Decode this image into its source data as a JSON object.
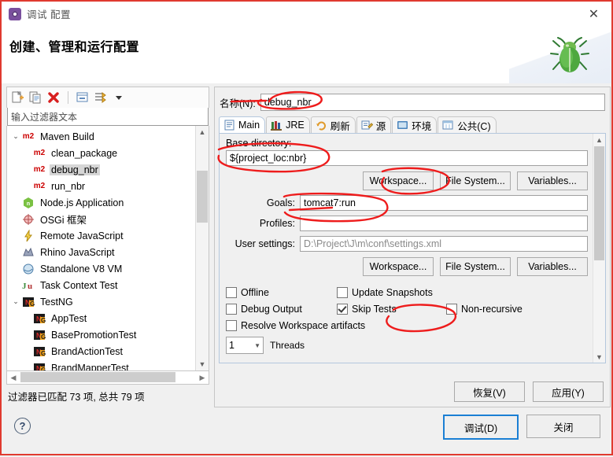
{
  "window": {
    "title": "调试 配置",
    "title_icon": "gear-icon",
    "close_icon": "✕",
    "heading": "创建、管理和运行配置",
    "banner_icon": "green-bug-icon"
  },
  "left_panel": {
    "toolbar": [
      {
        "name": "new-configuration-icon",
        "label": "新建"
      },
      {
        "name": "duplicate-configuration-icon",
        "label": "复制"
      },
      {
        "name": "delete-configuration-icon",
        "label": "删除"
      },
      {
        "name": "collapse-all-icon",
        "label": "全部折叠"
      },
      {
        "name": "filter-icon",
        "label": "过滤"
      },
      {
        "name": "toolbar-menu-chevron-icon",
        "label": "▾"
      }
    ],
    "filter_placeholder": "输入过滤器文本",
    "filter_value": "",
    "tree": [
      {
        "label": "Maven Build",
        "icon": "m2",
        "indent": 0,
        "expanded": true,
        "selected": false
      },
      {
        "label": "clean_package",
        "icon": "m2",
        "indent": 1,
        "selected": false
      },
      {
        "label": "debug_nbr",
        "icon": "m2",
        "indent": 1,
        "selected": true
      },
      {
        "label": "run_nbr",
        "icon": "m2",
        "indent": 1,
        "selected": false
      },
      {
        "label": "Node.js Application",
        "icon": "nodejs",
        "indent": 0,
        "selected": false
      },
      {
        "label": "OSGi 框架",
        "icon": "osgi",
        "indent": 0,
        "selected": false
      },
      {
        "label": "Remote JavaScript",
        "icon": "js-remote",
        "indent": 0,
        "selected": false
      },
      {
        "label": "Rhino JavaScript",
        "icon": "rhino",
        "indent": 0,
        "selected": false
      },
      {
        "label": "Standalone V8 VM",
        "icon": "v8",
        "indent": 0,
        "selected": false
      },
      {
        "label": "Task Context Test",
        "icon": "junit",
        "indent": 0,
        "selected": false
      },
      {
        "label": "TestNG",
        "icon": "testng",
        "indent": 0,
        "expanded": true,
        "selected": false
      },
      {
        "label": "AppTest",
        "icon": "testng",
        "indent": 1,
        "selected": false
      },
      {
        "label": "BasePromotionTest",
        "icon": "testng",
        "indent": 1,
        "selected": false
      },
      {
        "label": "BrandActionTest",
        "icon": "testng",
        "indent": 1,
        "selected": false
      },
      {
        "label": "BrandMapperTest",
        "icon": "testng",
        "indent": 1,
        "selected": false
      }
    ],
    "status": "过滤器已匹配 73 项, 总共 79 项"
  },
  "config": {
    "name_label": "名称(N):",
    "name_value": "debug_nbr",
    "tabs": [
      {
        "label": "Main",
        "icon": "main-tab-icon",
        "active": true
      },
      {
        "label": "JRE",
        "icon": "jre-tab-icon",
        "active": false
      },
      {
        "label": "刷新",
        "icon": "refresh-tab-icon",
        "active": false
      },
      {
        "label": "源",
        "icon": "source-tab-icon",
        "active": false
      },
      {
        "label": "环境",
        "icon": "environment-tab-icon",
        "active": false
      },
      {
        "label": "公共(C)",
        "icon": "common-tab-icon",
        "active": false
      }
    ],
    "base_directory_label": "Base directory:",
    "base_directory_value": "${project_loc:nbr}",
    "dir_buttons": [
      "Workspace...",
      "File System...",
      "Variables..."
    ],
    "goals_label": "Goals:",
    "goals_value": "tomcat7:run",
    "profiles_label": "Profiles:",
    "profiles_value": "",
    "user_settings_label": "User settings:",
    "user_settings_value": "D:\\Project\\J\\m\\conf\\settings.xml",
    "settings_buttons": [
      "Workspace...",
      "File System...",
      "Variables..."
    ],
    "checkboxes": [
      {
        "label": "Offline",
        "checked": false
      },
      {
        "label": "Update Snapshots",
        "checked": false
      },
      {
        "label": "Debug Output",
        "checked": false
      },
      {
        "label": "Skip Tests",
        "checked": true
      },
      {
        "label": "Non-recursive",
        "checked": false
      },
      {
        "label": "Resolve Workspace artifacts",
        "checked": false
      }
    ],
    "threads_value": "1",
    "threads_label": "Threads",
    "revert_label": "恢复(V)",
    "apply_label": "应用(Y)"
  },
  "footer": {
    "help_icon": "?",
    "debug_label": "调试(D)",
    "close_label": "关闭"
  },
  "colors": {
    "annotation": "#ee1c1c",
    "default_button_border": "#1b7fd4",
    "selection": "#d6d6d6"
  }
}
